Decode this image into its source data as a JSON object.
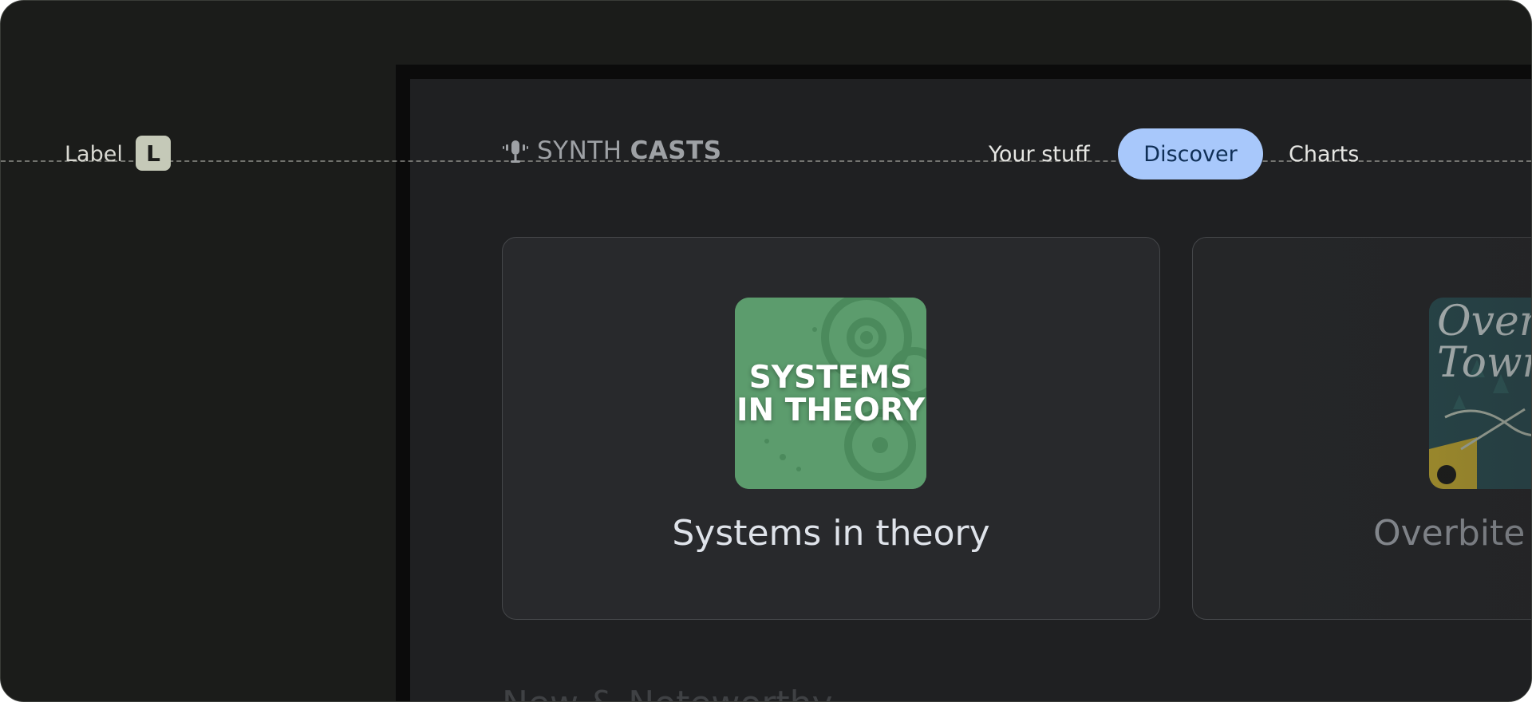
{
  "annotation": {
    "label": "Label",
    "key": "L"
  },
  "app": {
    "logo": {
      "word1": "SYNTH",
      "word2": "CASTS",
      "icon": "podcast-mic-icon"
    },
    "nav": [
      {
        "label": "Your stuff",
        "active": false
      },
      {
        "label": "Discover",
        "active": true
      },
      {
        "label": "Charts",
        "active": false
      }
    ],
    "cards": [
      {
        "cover_text": "SYSTEMS\nIN THEORY",
        "title": "Systems in theory"
      },
      {
        "cover_text": "Over\nTown",
        "title": "Overbite T"
      }
    ],
    "section_heading": "New & Noteworthy"
  },
  "colors": {
    "accent": "#a8c8fb",
    "background": "#1f2022",
    "card": "#28292c",
    "cover_green": "#5c9c6d"
  }
}
